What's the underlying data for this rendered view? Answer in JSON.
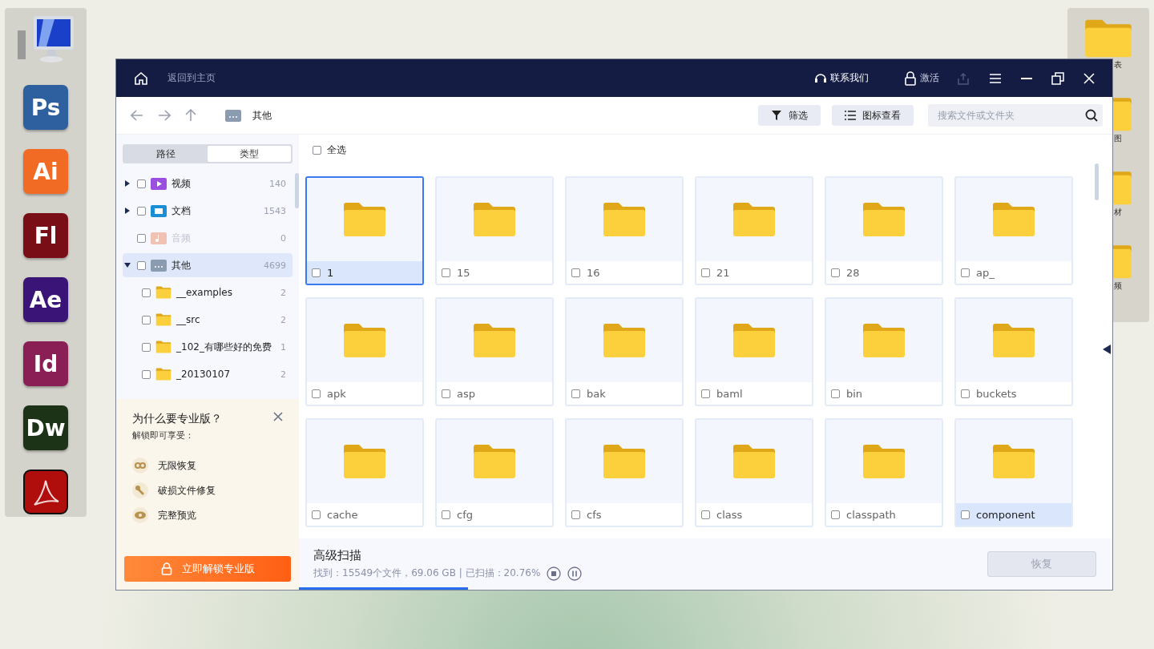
{
  "desktop_left_dock": [
    {
      "kind": "computer"
    },
    {
      "kind": "app",
      "label": "Ps",
      "color": "#2e5f9e"
    },
    {
      "kind": "app",
      "label": "Ai",
      "color": "#f26b24"
    },
    {
      "kind": "app",
      "label": "Fl",
      "color": "#7a0e16"
    },
    {
      "kind": "app",
      "label": "Ae",
      "color": "#3b1478"
    },
    {
      "kind": "app",
      "label": "Id",
      "color": "#8a1f55"
    },
    {
      "kind": "app",
      "label": "Dw",
      "color": "#1d3317"
    },
    {
      "kind": "pdf"
    }
  ],
  "desktop_right_dock": [
    {
      "label": "表"
    },
    {
      "label": "图"
    },
    {
      "label": "材"
    },
    {
      "label": "频"
    }
  ],
  "window": {
    "home_label": "返回到主页",
    "contact": "联系我们",
    "activate": "激活"
  },
  "toolbar": {
    "location": "其他",
    "filter_button": "筛选",
    "view_button": "图标查看",
    "search": {
      "placeholder": "搜索文件或文件夹"
    }
  },
  "sidebar": {
    "tabs": [
      {
        "label": "路径",
        "selected": false
      },
      {
        "label": "类型",
        "selected": true
      }
    ],
    "tree": [
      {
        "kind": "video",
        "label": "视频",
        "count": "140",
        "checked": false,
        "expanded": false,
        "selected": false,
        "disabled": false
      },
      {
        "kind": "document",
        "label": "文档",
        "count": "1543",
        "checked": false,
        "expanded": false,
        "selected": false,
        "disabled": false
      },
      {
        "kind": "audio",
        "label": "音频",
        "count": "0",
        "checked": false,
        "selected": false,
        "disabled": true
      },
      {
        "kind": "other",
        "label": "其他",
        "count": "4699",
        "checked": false,
        "expanded": true,
        "selected": true,
        "disabled": false,
        "children": [
          {
            "kind": "folder",
            "label": "__examples",
            "count": "2",
            "checked": false,
            "selected": false,
            "disabled": false
          },
          {
            "kind": "folder",
            "label": "__src",
            "count": "2",
            "checked": false,
            "selected": false,
            "disabled": false
          },
          {
            "kind": "folder",
            "label": "_102_有哪些好的免费",
            "count": "1",
            "checked": false,
            "selected": false,
            "disabled": false
          },
          {
            "kind": "folder",
            "label": "_20130107",
            "count": "2",
            "checked": false,
            "selected": false,
            "disabled": false
          }
        ]
      }
    ]
  },
  "promo": {
    "title": "为什么要专业版？",
    "subtitle": "解锁即可享受：",
    "features": [
      {
        "kind": "unlimited",
        "label": "无限恢复"
      },
      {
        "kind": "repair",
        "label": "破损文件修复"
      },
      {
        "kind": "preview",
        "label": "完整预览"
      }
    ],
    "button": "立即解锁专业版"
  },
  "select_all": {
    "label": "全选",
    "checked": false
  },
  "tiles": [
    {
      "label": "1",
      "selected": true,
      "hovered": false,
      "checked": false
    },
    {
      "label": "15",
      "selected": false,
      "hovered": false,
      "checked": false
    },
    {
      "label": "16",
      "selected": false,
      "hovered": false,
      "checked": false
    },
    {
      "label": "21",
      "selected": false,
      "hovered": false,
      "checked": false
    },
    {
      "label": "28",
      "selected": false,
      "hovered": false,
      "checked": false
    },
    {
      "label": "ap_",
      "selected": false,
      "hovered": false,
      "checked": false
    },
    {
      "label": "apk",
      "selected": false,
      "hovered": false,
      "checked": false
    },
    {
      "label": "asp",
      "selected": false,
      "hovered": false,
      "checked": false
    },
    {
      "label": "bak",
      "selected": false,
      "hovered": false,
      "checked": false
    },
    {
      "label": "baml",
      "selected": false,
      "hovered": false,
      "checked": false
    },
    {
      "label": "bin",
      "selected": false,
      "hovered": false,
      "checked": false
    },
    {
      "label": "buckets",
      "selected": false,
      "hovered": false,
      "checked": false
    },
    {
      "label": "cache",
      "selected": false,
      "hovered": false,
      "checked": false
    },
    {
      "label": "cfg",
      "selected": false,
      "hovered": false,
      "checked": false
    },
    {
      "label": "cfs",
      "selected": false,
      "hovered": false,
      "checked": false
    },
    {
      "label": "class",
      "selected": false,
      "hovered": false,
      "checked": false
    },
    {
      "label": "classpath",
      "selected": false,
      "hovered": false,
      "checked": false
    },
    {
      "label": "component",
      "selected": false,
      "hovered": true,
      "checked": false
    }
  ],
  "scan": {
    "title": "高级扫描",
    "status": "找到：15549个文件，69.06 GB | 已扫描：20.76%",
    "level": 0.2076,
    "recover_button": {
      "label": "恢复",
      "disabled": true
    }
  }
}
